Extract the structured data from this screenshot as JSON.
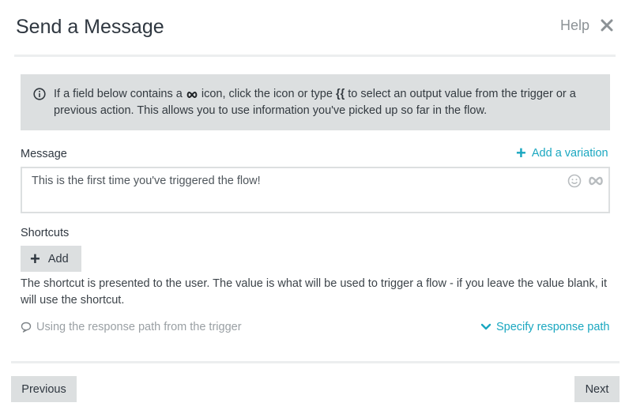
{
  "dialog": {
    "title": "Send a Message",
    "help_label": "Help"
  },
  "info": {
    "text_before_icon": "If a field below contains a",
    "text_after_icon": "icon, click the icon or type",
    "braces": "{{",
    "text_after_braces": "to select an output value from the trigger or a previous action. This allows you to use information you've picked up so far in the flow."
  },
  "message": {
    "label": "Message",
    "add_variation_label": "Add a variation",
    "value": "This is the first time you've triggered the flow!"
  },
  "shortcuts": {
    "label": "Shortcuts",
    "add_label": "Add",
    "description": "The shortcut is presented to the user. The value is what will be used to trigger a flow - if you leave the value blank, it will use the shortcut."
  },
  "response": {
    "status_text": "Using the response path from the trigger",
    "specify_label": "Specify response path"
  },
  "footer": {
    "previous_label": "Previous",
    "next_label": "Next"
  },
  "colors": {
    "accent": "#1aa7c0",
    "panel_gray": "#dcdfe0",
    "text_dark": "#2f3740"
  },
  "icons": {
    "close": "close-icon",
    "info": "info-circle-icon",
    "variable": "infinity-icon",
    "emoji": "smiley-icon",
    "plus": "plus-icon",
    "response": "speech-bubble-icon",
    "chevron": "chevron-down-icon"
  }
}
